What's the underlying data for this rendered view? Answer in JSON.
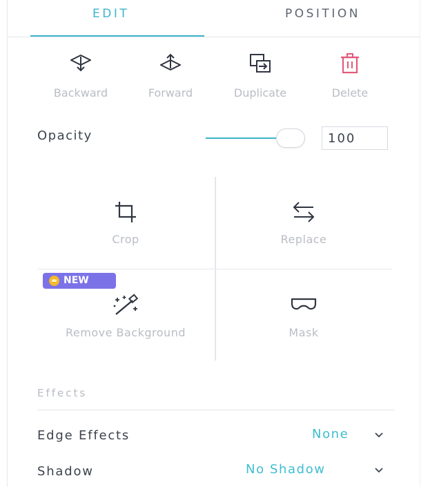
{
  "tabs": [
    {
      "label": "EDIT",
      "active": true
    },
    {
      "label": "POSITION",
      "active": false
    }
  ],
  "actions": [
    {
      "label": "Backward",
      "icon": "send-backward-icon"
    },
    {
      "label": "Forward",
      "icon": "bring-forward-icon"
    },
    {
      "label": "Duplicate",
      "icon": "duplicate-icon"
    },
    {
      "label": "Delete",
      "icon": "trash-icon"
    }
  ],
  "opacity": {
    "label": "Opacity",
    "value": "100",
    "slider_percent": 100
  },
  "tools": [
    {
      "label": "Crop",
      "icon": "crop-icon"
    },
    {
      "label": "Replace",
      "icon": "swap-arrows-icon"
    },
    {
      "label": "Remove Background",
      "icon": "magic-wand-icon",
      "badge": "NEW"
    },
    {
      "label": "Mask",
      "icon": "mask-icon"
    }
  ],
  "effects": {
    "heading": "Effects",
    "edge": {
      "label": "Edge Effects",
      "value": "None"
    },
    "shadow": {
      "label": "Shadow",
      "value": "No Shadow"
    }
  },
  "colors": {
    "accent": "#3bb6c9",
    "delete": "#e35a7c",
    "badge": "#7c72e8",
    "muted": "#b9bdc4"
  }
}
